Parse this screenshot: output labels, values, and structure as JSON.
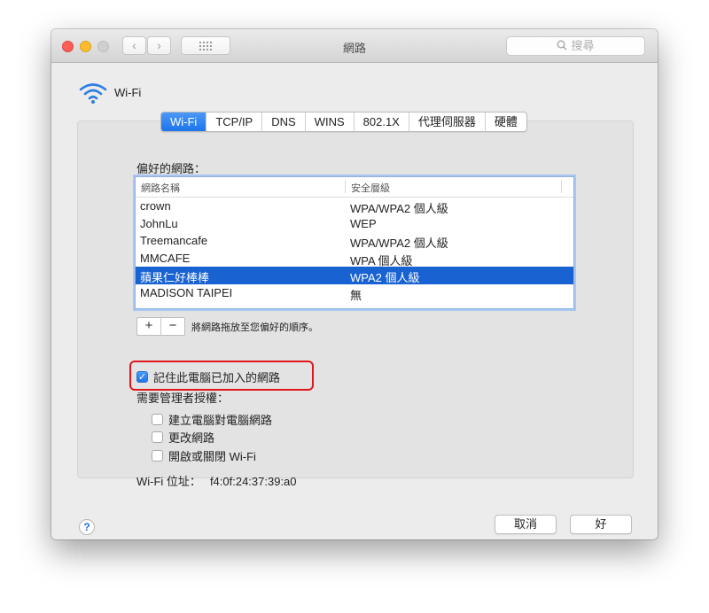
{
  "window": {
    "title": "網路",
    "search_placeholder": "搜尋"
  },
  "header": {
    "label": "Wi-Fi"
  },
  "tabs": [
    {
      "label": "Wi-Fi",
      "active": true
    },
    {
      "label": "TCP/IP"
    },
    {
      "label": "DNS"
    },
    {
      "label": "WINS"
    },
    {
      "label": "802.1X"
    },
    {
      "label": "代理伺服器"
    },
    {
      "label": "硬體"
    }
  ],
  "preferred": {
    "label": "偏好的網路：",
    "columns": [
      "網路名稱",
      "安全層級"
    ],
    "rows": [
      {
        "name": "crown",
        "security": "WPA/WPA2 個人級"
      },
      {
        "name": "JohnLu",
        "security": "WEP"
      },
      {
        "name": "Treemancafe",
        "security": "WPA/WPA2 個人級"
      },
      {
        "name": "MMCAFE",
        "security": "WPA 個人級"
      },
      {
        "name": "蘋果仁好棒棒",
        "security": "WPA2 個人級",
        "selected": true
      },
      {
        "name": "MADISON TAIPEI",
        "security": "無"
      }
    ],
    "add_label": "+",
    "remove_label": "−",
    "drag_hint": "將網路拖放至您偏好的順序。"
  },
  "remember": {
    "label": "記住此電腦已加入的網路",
    "checked": true
  },
  "admin": {
    "label": "需要管理者授權：",
    "options": [
      {
        "label": "建立電腦對電腦網路",
        "checked": false
      },
      {
        "label": "更改網路",
        "checked": false
      },
      {
        "label": "開啟或關閉 Wi-Fi",
        "checked": false
      }
    ]
  },
  "mac": {
    "label": "Wi-Fi 位址：",
    "value": "f4:0f:24:37:39:a0"
  },
  "buttons": {
    "help": "?",
    "cancel": "取消",
    "ok": "好"
  },
  "colors": {
    "accent": "#1962d2",
    "highlight_box": "#e0161c"
  }
}
